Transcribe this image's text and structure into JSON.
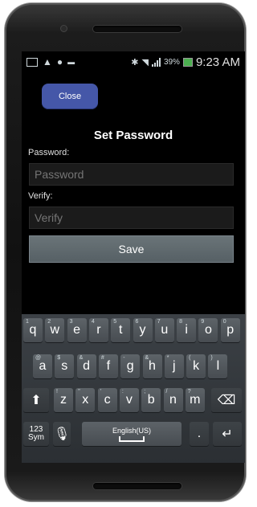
{
  "status_bar": {
    "battery_percent": "39%",
    "time": "9:23 AM"
  },
  "close_button": {
    "label": "Close"
  },
  "dialog": {
    "title": "Set Password",
    "password_label": "Password:",
    "password_placeholder": "Password",
    "verify_label": "Verify:",
    "verify_placeholder": "Verify",
    "save_label": "Save"
  },
  "keyboard": {
    "row1": [
      {
        "k": "q",
        "h": "1"
      },
      {
        "k": "w",
        "h": "2"
      },
      {
        "k": "e",
        "h": "3"
      },
      {
        "k": "r",
        "h": "4"
      },
      {
        "k": "t",
        "h": "5"
      },
      {
        "k": "y",
        "h": "6"
      },
      {
        "k": "u",
        "h": "7"
      },
      {
        "k": "i",
        "h": "8"
      },
      {
        "k": "o",
        "h": "9"
      },
      {
        "k": "p",
        "h": "0"
      }
    ],
    "row2": [
      {
        "k": "a",
        "h": "@"
      },
      {
        "k": "s",
        "h": "$"
      },
      {
        "k": "d",
        "h": "&"
      },
      {
        "k": "f",
        "h": "#"
      },
      {
        "k": "g",
        "h": "-"
      },
      {
        "k": "h",
        "h": "&"
      },
      {
        "k": "j",
        "h": "*"
      },
      {
        "k": "k",
        "h": "("
      },
      {
        "k": "l",
        "h": ")"
      }
    ],
    "row3": [
      {
        "k": "z",
        "h": "!"
      },
      {
        "k": "x",
        "h": "\""
      },
      {
        "k": "c",
        "h": "'"
      },
      {
        "k": "v",
        "h": ":"
      },
      {
        "k": "b",
        "h": ";"
      },
      {
        "k": "n",
        "h": "/"
      },
      {
        "k": "m",
        "h": "?"
      }
    ],
    "sym_top": "123",
    "sym_bottom": "Sym",
    "space_label": "English(US)",
    "period": "."
  }
}
